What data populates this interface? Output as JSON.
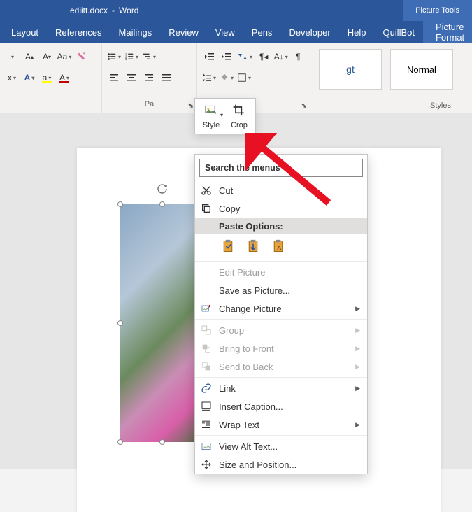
{
  "title": {
    "filename": "ediitt.docx",
    "app": "Word",
    "contextual": "Picture Tools"
  },
  "tabs": [
    "Layout",
    "References",
    "Mailings",
    "Review",
    "View",
    "Pens",
    "Developer",
    "Help",
    "QuillBot"
  ],
  "contextual_tab": "Picture Format",
  "ribbon": {
    "group_paragraph": "Pa",
    "group_styles": "Styles",
    "style1": "gt",
    "style2": "Normal"
  },
  "mini": {
    "style": "Style",
    "crop": "Crop"
  },
  "menu": {
    "search": "Search the menus",
    "cut": "Cut",
    "copy": "Copy",
    "paste_header": "Paste Options:",
    "edit_picture": "Edit Picture",
    "save_as": "Save as Picture...",
    "change": "Change Picture",
    "group": "Group",
    "bring_front": "Bring to Front",
    "send_back": "Send to Back",
    "link": "Link",
    "caption": "Insert Caption...",
    "wrap": "Wrap Text",
    "alt": "View Alt Text...",
    "size_pos": "Size and Position..."
  }
}
